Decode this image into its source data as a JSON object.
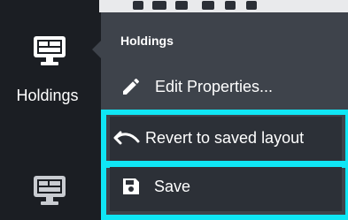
{
  "sidebar": {
    "items": [
      {
        "label": "Holdings",
        "icon": "desktop-dashboard-icon"
      },
      {
        "label": "",
        "icon": "desktop-dashboard-icon"
      }
    ]
  },
  "menu": {
    "header": "Holdings",
    "items": [
      {
        "label": "Edit Properties...",
        "icon": "pencil-icon",
        "highlighted": false
      },
      {
        "label": "Revert to saved layout",
        "icon": "undo-icon",
        "highlighted": true
      },
      {
        "label": "Save",
        "icon": "floppy-disk-icon",
        "highlighted": true
      }
    ]
  },
  "colors": {
    "background": "#1b1e23",
    "menu": "#3e434b",
    "highlight": "#0fe6f5",
    "text": "#ffffff"
  }
}
